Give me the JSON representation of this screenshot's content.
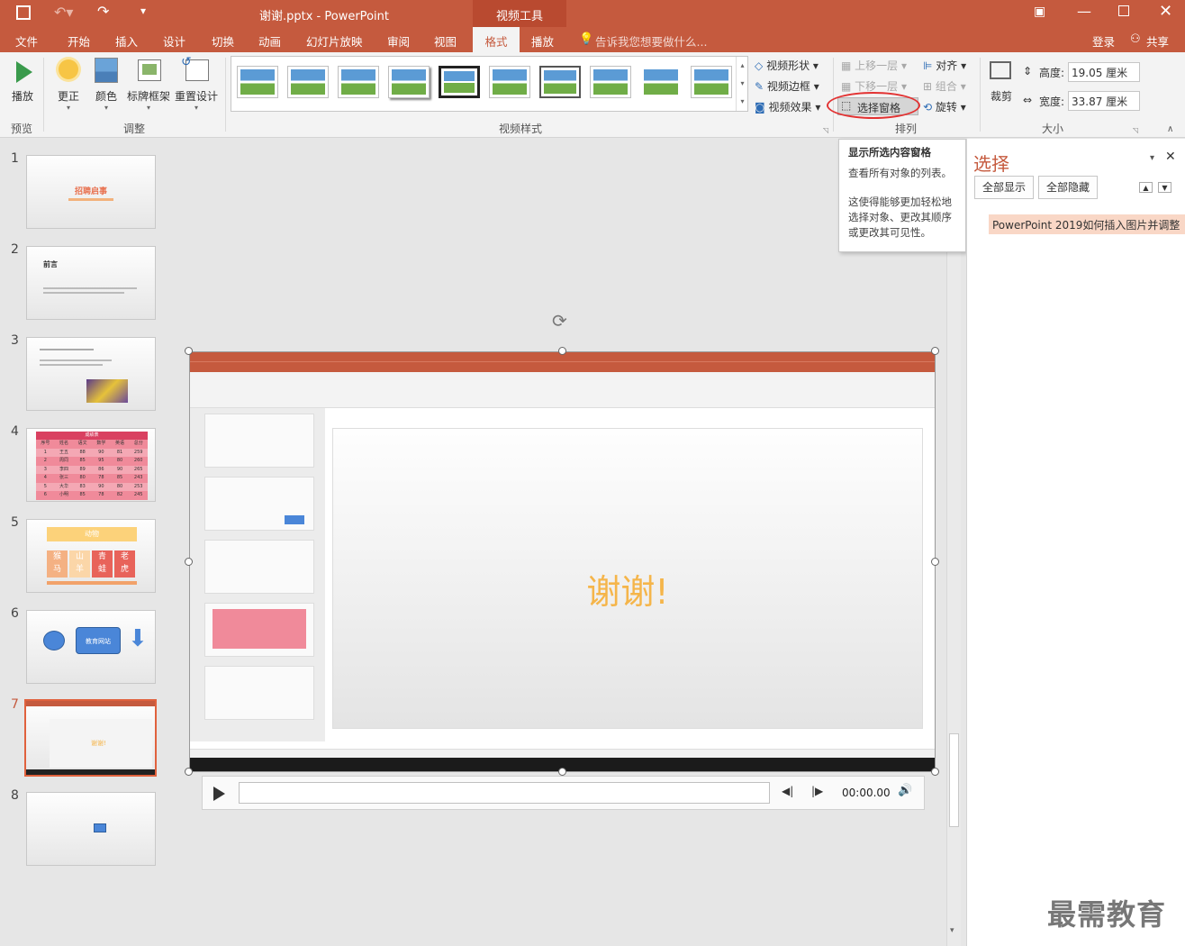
{
  "window": {
    "title": "谢谢.pptx - PowerPoint",
    "context_tab": "视频工具"
  },
  "tabs": [
    "文件",
    "开始",
    "插入",
    "设计",
    "切换",
    "动画",
    "幻灯片放映",
    "审阅",
    "视图",
    "格式",
    "播放"
  ],
  "active_tab": "格式",
  "tell_me": "告诉我您想要做什么...",
  "account": {
    "login": "登录",
    "share": "共享"
  },
  "ribbon": {
    "preview": {
      "play": "播放",
      "group": "预览"
    },
    "adjust": {
      "correct": "更正",
      "color": "颜色",
      "poster_frame": "标牌框架",
      "reset": "重置设计",
      "group": "调整"
    },
    "video_styles": {
      "group": "视频样式",
      "shape": "视频形状",
      "border": "视频边框",
      "effects": "视频效果"
    },
    "arrange": {
      "bring_forward": "上移一层",
      "send_backward": "下移一层",
      "selection_pane": "选择窗格",
      "align": "对齐",
      "group_btn": "组合",
      "rotate": "旋转",
      "group": "排列"
    },
    "size": {
      "crop": "裁剪",
      "height_label": "高度:",
      "height_value": "19.05 厘米",
      "width_label": "宽度:",
      "width_value": "33.87 厘米",
      "group": "大小"
    }
  },
  "tooltip": {
    "title": "显示所选内容窗格",
    "line1": "查看所有对象的列表。",
    "line2": "这使得能够更加轻松地选择对象、更改其顺序或更改其可见性。"
  },
  "selection_pane": {
    "title": "选择",
    "show_all": "全部显示",
    "hide_all": "全部隐藏",
    "item": "PowerPoint 2019如何插入图片并调整"
  },
  "slides": {
    "numbers": [
      "1",
      "2",
      "3",
      "4",
      "5",
      "6",
      "7",
      "8"
    ],
    "s1_title": "招聘启事",
    "s2_title": "前言",
    "s4_header": "成绩表",
    "s4_cols": [
      "序号",
      "姓名",
      "语文",
      "数学",
      "英语",
      "总分"
    ],
    "s4_rows": [
      [
        "1",
        "王五",
        "88",
        "90",
        "81",
        "259"
      ],
      [
        "2",
        "周同",
        "85",
        "95",
        "80",
        "260"
      ],
      [
        "3",
        "李四",
        "89",
        "86",
        "90",
        "265"
      ],
      [
        "4",
        "张三",
        "80",
        "78",
        "85",
        "243"
      ],
      [
        "5",
        "大华",
        "83",
        "90",
        "80",
        "253"
      ],
      [
        "6",
        "小明",
        "85",
        "78",
        "82",
        "245"
      ]
    ],
    "s5_title": "动物",
    "s5_chars": [
      [
        "猴",
        "山",
        "青",
        "老"
      ],
      [
        "马",
        "羊",
        "蛙",
        "虎"
      ]
    ],
    "s6_label": "教育网站",
    "s7_text": "谢谢!"
  },
  "video": {
    "slide_text": "谢谢!",
    "time": "00:00.00"
  },
  "watermark": "最需教育",
  "colors": {
    "accent": "#c55a3e",
    "slide_text": "#f5b54a",
    "highlight": "#f9d7c6"
  }
}
